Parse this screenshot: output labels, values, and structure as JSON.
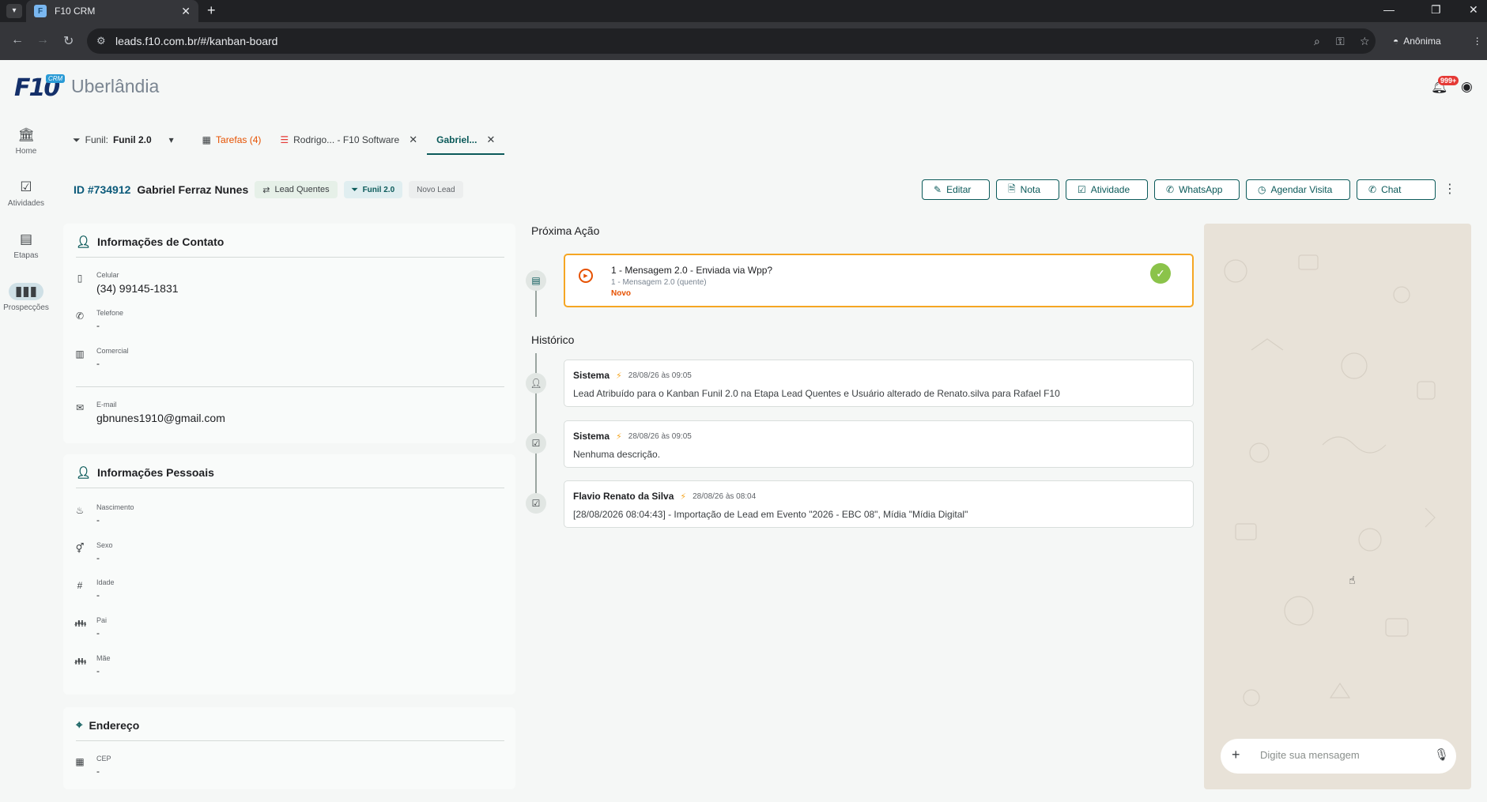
{
  "browser": {
    "tab_title": "F10 CRM",
    "favicon": "F",
    "url": "leads.f10.com.br/#/kanban-board",
    "profile": "Anônima"
  },
  "app": {
    "logo_text": "F10",
    "logo_badge": "CRM",
    "city": "Uberlândia",
    "notifications": "999+"
  },
  "sidebar": [
    {
      "label": "Home",
      "icon": "bank-icon"
    },
    {
      "label": "Atividades",
      "icon": "checklist-icon"
    },
    {
      "label": "Etapas",
      "icon": "board-icon"
    },
    {
      "label": "Prospecções",
      "icon": "columns-icon"
    }
  ],
  "tabs": {
    "funil_prefix": "Funil:",
    "funil_value": "Funil 2.0",
    "tarefas": "Tarefas (4)",
    "rodrigo": "Rodrigo... - F10 Software",
    "gabriel": "Gabriel..."
  },
  "lead": {
    "id": "ID #734912",
    "name": "Gabriel Ferraz Nunes",
    "chip_stage": "Lead Quentes",
    "chip_funnel": "Funil 2.0",
    "chip_status": "Novo Lead"
  },
  "actions": {
    "editar": "Editar",
    "nota": "Nota",
    "atividade": "Atividade",
    "whatsapp": "WhatsApp",
    "agendar": "Agendar Visita",
    "chat": "Chat"
  },
  "contact": {
    "title": "Informações de Contato",
    "celular_label": "Celular",
    "celular": "(34) 99145-1831",
    "telefone_label": "Telefone",
    "telefone": "-",
    "comercial_label": "Comercial",
    "comercial": "-",
    "email_label": "E-mail",
    "email": "gbnunes1910@gmail.com"
  },
  "personal": {
    "title": "Informações Pessoais",
    "nascimento_label": "Nascimento",
    "nascimento": "-",
    "sexo_label": "Sexo",
    "sexo": "-",
    "idade_label": "Idade",
    "idade": "-",
    "pai_label": "Pai",
    "pai": "-",
    "mae_label": "Mãe",
    "mae": "-"
  },
  "address": {
    "title": "Endereço",
    "cep_label": "CEP",
    "cep": "-"
  },
  "next_action": {
    "section": "Próxima Ação",
    "title": "1 - Mensagem 2.0 - Enviada via Wpp?",
    "subtitle": "1 - Mensagem 2.0 (quente)",
    "status": "Novo"
  },
  "history": {
    "section": "Histórico",
    "entries": [
      {
        "who": "Sistema",
        "when": "28/08/26 às 09:05",
        "text": "Lead Atribuído para o Kanban Funil 2.0 na Etapa Lead Quentes e Usuário alterado de Renato.silva para Rafael F10"
      },
      {
        "who": "Sistema",
        "when": "28/08/26 às 09:05",
        "text": "Nenhuma descrição."
      },
      {
        "who": "Flavio Renato da Silva",
        "when": "28/08/26 às 08:04",
        "text": "[28/08/2026 08:04:43] - Importação de Lead em Evento \"2026 - EBC 08\", Mídia \"Mídia Digital\""
      }
    ]
  },
  "chat": {
    "placeholder": "Digite sua mensagem"
  },
  "colors": {
    "primary": "#0b5a5a",
    "accent_orange": "#e65100",
    "highlight_border": "#f5a623",
    "success": "#8bc34a"
  }
}
